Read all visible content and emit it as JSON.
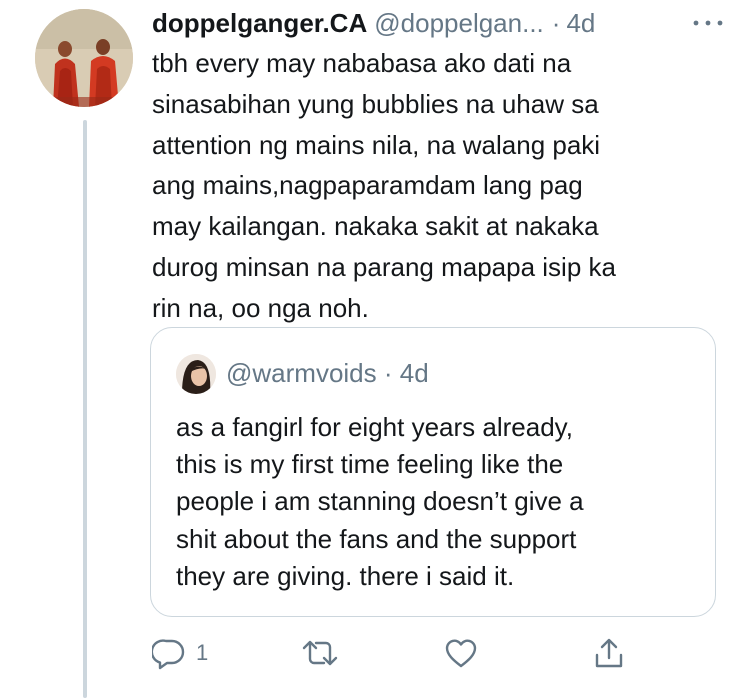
{
  "tweet": {
    "display_name": "doppelganger.CA",
    "handle": "@doppelgan...",
    "separator": "·",
    "time": "4d",
    "text_lines": [
      "tbh every may nababasa ako dati na",
      "sinasabihan yung bubblies na uhaw sa",
      "attention ng mains nila, na walang paki",
      "ang mains,nagpaparamdam lang pag",
      "may kailangan. nakaka sakit at nakaka",
      "durog minsan na parang mapapa isip ka",
      "rin na, oo nga noh."
    ]
  },
  "quoted_tweet": {
    "handle": "@warmvoids",
    "separator": "·",
    "time": "4d",
    "text_lines": [
      "as a fangirl for eight years already,",
      "this is my first time feeling like the",
      "people i am stanning doesn’t give a",
      "shit about the fans and the support",
      "they are giving. there i said it."
    ]
  },
  "actions": {
    "reply_count": "1"
  },
  "icons": {
    "more": "more-horizontal-icon",
    "reply": "reply-icon",
    "retweet": "retweet-icon",
    "like": "heart-icon",
    "share": "share-icon"
  },
  "colors": {
    "text": "#14171a",
    "secondary": "#657786",
    "border": "#ccd6dd"
  }
}
